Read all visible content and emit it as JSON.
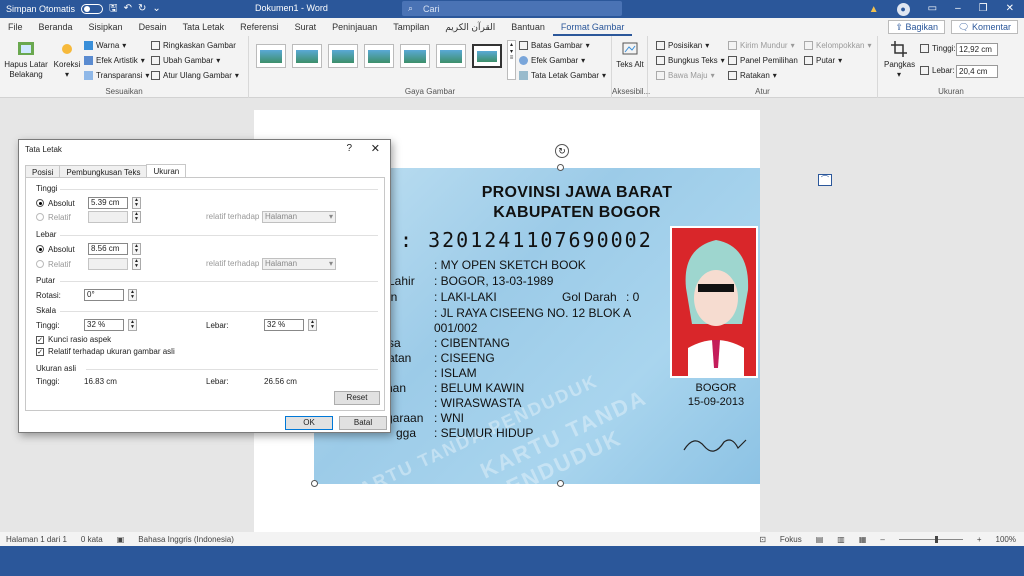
{
  "titlebar": {
    "autosave_label": "Simpan Otomatis",
    "doc_title": "Dokumen1 - Word",
    "search_placeholder": "Cari",
    "account_icon": "person-icon"
  },
  "tabs": [
    "File",
    "Beranda",
    "Sisipkan",
    "Desain",
    "Tata Letak",
    "Referensi",
    "Surat",
    "Peninjauan",
    "Tampilan",
    "القرآن الكريم",
    "Bantuan",
    "Format Gambar"
  ],
  "active_tab": "Format Gambar",
  "share_label": "Bagikan",
  "comment_label": "Komentar",
  "ribbon": {
    "remove_bg": "Hapus Latar Belakang",
    "correction": "Koreksi",
    "color": "Warna",
    "artistic": "Efek Artistik",
    "transparency": "Transparansi",
    "compress": "Ringkaskan Gambar",
    "change": "Ubah Gambar",
    "reset": "Atur Ulang Gambar",
    "group_adjust": "Sesuaikan",
    "border": "Batas Gambar",
    "effects": "Efek Gambar",
    "pic_layout": "Tata Letak Gambar",
    "group_styles": "Gaya Gambar",
    "alt_text": "Teks Alt",
    "group_access": "Aksesibil...",
    "position": "Posisikan",
    "wrap": "Bungkus Teks",
    "forward": "Bawa Maju",
    "backward": "Kirim Mundur",
    "selection_pane": "Panel Pemilihan",
    "align": "Ratakan",
    "group": "Kelompokkan",
    "rotate": "Putar",
    "group_arrange": "Atur",
    "crop": "Pangkas",
    "height_label": "Tinggi:",
    "height_value": "12,92 cm",
    "width_label": "Lebar:",
    "width_value": "20,4 cm",
    "group_size": "Ukuran"
  },
  "card": {
    "province": "PROVINSI JAWA BARAT",
    "regency": "KABUPATEN BOGOR",
    "nik": ": 3201241107690002",
    "rows": [
      {
        "label": "",
        "value": ": MY OPEN SKETCH BOOK"
      },
      {
        "label": "Lahir",
        "value": ": BOGOR, 13-03-1989"
      },
      {
        "label": "in",
        "value": ": LAKI-LAKI"
      },
      {
        "label": "",
        "value": ": JL RAYA CISEENG NO. 12 BLOK A"
      },
      {
        "label": "",
        "value": "001/002"
      },
      {
        "label": "sa",
        "value": ": CIBENTANG"
      },
      {
        "label": "atan",
        "value": ": CISEENG"
      },
      {
        "label": "",
        "value": ": ISLAM"
      },
      {
        "label": "awinan",
        "value": ": BELUM KAWIN"
      },
      {
        "label": "",
        "value": ": WIRASWASTA"
      },
      {
        "label": "garaan",
        "value": ": WNI"
      },
      {
        "label": "gga",
        "value": ": SEUMUR HIDUP"
      }
    ],
    "blood_label": "Gol Darah",
    "blood_value": ": 0",
    "city": "BOGOR",
    "date": "15-09-2013",
    "watermark": "KARTU TANDA PENDUDUK"
  },
  "dialog": {
    "title": "Tata Letak",
    "help": "?",
    "tabs": [
      "Posisi",
      "Pembungkusan Teks",
      "Ukuran"
    ],
    "active_tab": "Ukuran",
    "height_section": "Tinggi",
    "absolute": "Absolut",
    "relative": "Relatif",
    "relative_to": "relatif terhadap",
    "height_abs_value": "5.39 cm",
    "page_option": "Halaman",
    "width_section": "Lebar",
    "width_abs_value": "8.56 cm",
    "rotate_section": "Putar",
    "rotation_label": "Rotasi:",
    "rotation_value": "0°",
    "scale_section": "Skala",
    "scale_height_label": "Tinggi:",
    "scale_height_value": "32 %",
    "scale_width_label": "Lebar:",
    "scale_width_value": "32 %",
    "lock_ratio": "Kunci rasio aspek",
    "relative_original": "Relatif terhadap ukuran gambar asli",
    "original_section": "Ukuran asli",
    "orig_height_label": "Tinggi:",
    "orig_height_value": "16.83 cm",
    "orig_width_label": "Lebar:",
    "orig_width_value": "26.56 cm",
    "reset_btn": "Reset",
    "ok_btn": "OK",
    "cancel_btn": "Batal"
  },
  "status": {
    "page": "Halaman 1 dari 1",
    "words": "0 kata",
    "language": "Bahasa Inggris (Indonesia)",
    "focus": "Fokus",
    "zoom": "100%"
  }
}
